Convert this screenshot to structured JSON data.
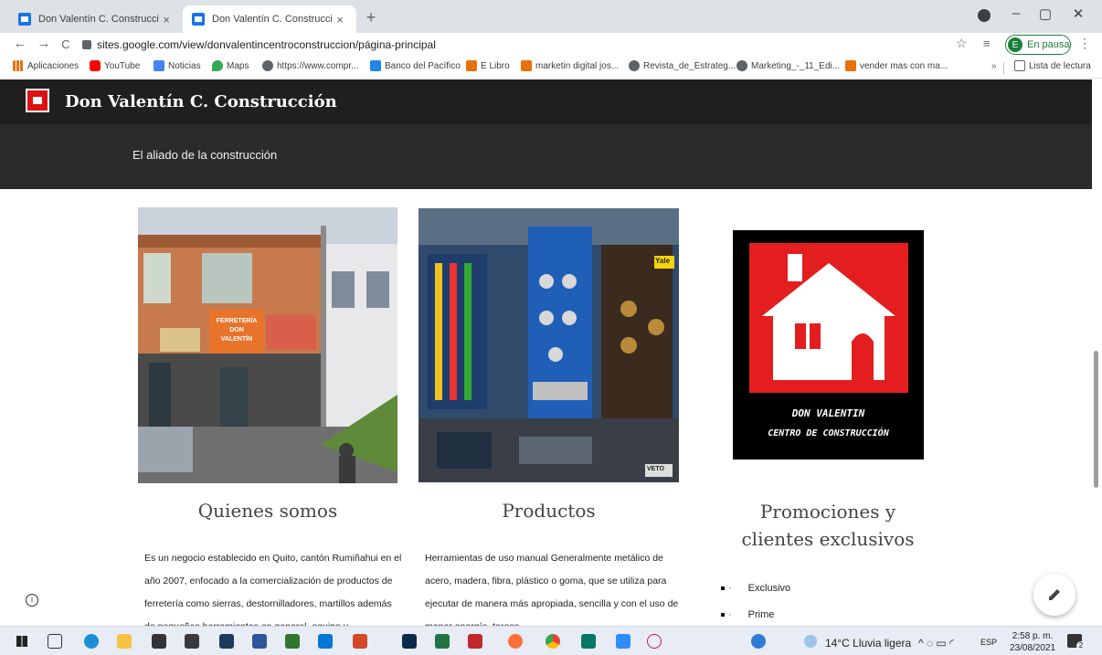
{
  "browser": {
    "tabs": [
      {
        "title": "Don Valentín C. Construcción",
        "close": "×"
      },
      {
        "title": "Don Valentín C. Construcción",
        "close": "×"
      }
    ],
    "new_tab": "+",
    "window_controls": {
      "minimize": "–",
      "maximize": "▢",
      "close": "✕"
    },
    "nav": {
      "back": "←",
      "forward": "→",
      "reload": "C"
    },
    "url": "sites.google.com/view/donvalentincentroconstruccion/página-principal",
    "profile_status": "En pausa",
    "profile_initial": "E",
    "bookmarks": [
      {
        "label": "Aplicaciones",
        "icon": "apps-grid-icon",
        "color": "#e8710a"
      },
      {
        "label": "YouTube",
        "icon": "youtube-icon",
        "color": "#ff0000"
      },
      {
        "label": "Noticias",
        "icon": "news-icon",
        "color": "#4285f4"
      },
      {
        "label": "Maps",
        "icon": "maps-pin-icon",
        "color": "#34a853"
      },
      {
        "label": "https://www.compr...",
        "icon": "globe-icon",
        "color": "#5f6368"
      },
      {
        "label": "Banco del Pacífico",
        "icon": "bank-icon",
        "color": "#1565c0"
      },
      {
        "label": "E Libro",
        "icon": "elibro-icon",
        "color": "#e8710a"
      },
      {
        "label": "marketin digital jos...",
        "icon": "elibro-icon",
        "color": "#e8710a"
      },
      {
        "label": "Revista_de_Estrateg...",
        "icon": "globe-icon",
        "color": "#5f6368"
      },
      {
        "label": "Marketing_-_11_Edi...",
        "icon": "globe-icon",
        "color": "#5f6368"
      },
      {
        "label": "vender mas con ma...",
        "icon": "elibro-icon",
        "color": "#e8710a"
      }
    ],
    "more": "»",
    "reading_list": "Lista de lectura"
  },
  "site": {
    "title": "Don Valentín C. Construcción",
    "tagline": "El aliado de la construcción",
    "cards": [
      {
        "title": "Quienes somos",
        "photo_sign": [
          "FERRETERÍA",
          "DON",
          "VALENTÍN"
        ],
        "paragraph": "Es un negocio establecido en Quito, cantón Rumiñahui en el año 2007, enfocado a la comercialización de productos de ferretería como sierras, destornilladores, martillos además de pequeñas herramientas en general, equipo y"
      },
      {
        "title": "Productos",
        "photo_brand": "Yale",
        "photo_brand2": "VETO",
        "paragraph": "Herramientas de uso manual Generalmente metálico de acero, madera, fibra, plástico o goma, que se utiliza para ejecutar de manera más apropiada, sencilla y con el uso de menor energía, tareas"
      },
      {
        "title": "Promociones y clientes exclusivos",
        "logo_line1": "DON VALENTIN",
        "logo_line2": "CENTRO DE CONSTRUCCIÓN",
        "bullets": [
          "Exclusivo",
          "Prime"
        ]
      }
    ]
  },
  "taskbar": {
    "weather": "14°C  Lluvia ligera",
    "lang": "ESP",
    "time": "2:58 p. m.",
    "date": "23/08/2021",
    "notifications": "2"
  }
}
